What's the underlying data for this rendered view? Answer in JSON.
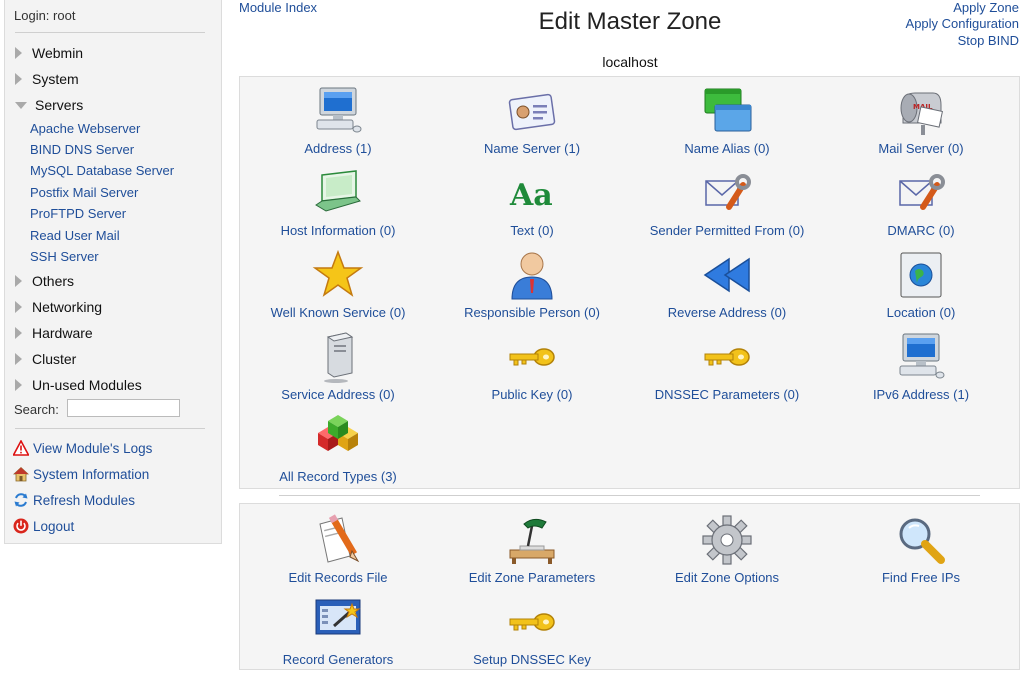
{
  "sidebar": {
    "login": "Login: root",
    "categories": [
      {
        "label": "Webmin"
      },
      {
        "label": "System"
      },
      {
        "label": "Servers"
      },
      {
        "label": "Others"
      },
      {
        "label": "Networking"
      },
      {
        "label": "Hardware"
      },
      {
        "label": "Cluster"
      },
      {
        "label": "Un-used Modules"
      }
    ],
    "servers": [
      "Apache Webserver",
      "BIND DNS Server",
      "MySQL Database Server",
      "Postfix Mail Server",
      "ProFTPD Server",
      "Read User Mail",
      "SSH Server"
    ],
    "search_label": "Search:",
    "search_value": "",
    "links": [
      {
        "label": "View Module's Logs",
        "icon": "warning-icon"
      },
      {
        "label": "System Information",
        "icon": "house-icon"
      },
      {
        "label": "Refresh Modules",
        "icon": "refresh-icon"
      },
      {
        "label": "Logout",
        "icon": "power-icon"
      }
    ]
  },
  "header": {
    "module_index": "Module Index",
    "title": "Edit Master Zone",
    "subtitle": "localhost",
    "right_links": [
      "Apply Zone",
      "Apply Configuration",
      "Stop BIND"
    ]
  },
  "records": [
    {
      "label": "Address (1)",
      "icon": "computer-icon"
    },
    {
      "label": "Name Server (1)",
      "icon": "id-card-icon"
    },
    {
      "label": "Name Alias (0)",
      "icon": "windows-icon"
    },
    {
      "label": "Mail Server (0)",
      "icon": "mailbox-icon"
    },
    {
      "label": "Host Information (0)",
      "icon": "laptop-icon"
    },
    {
      "label": "Text (0)",
      "icon": "text-aa-icon"
    },
    {
      "label": "Sender Permitted From (0)",
      "icon": "mail-wrench-icon"
    },
    {
      "label": "DMARC (0)",
      "icon": "mail-wrench-icon"
    },
    {
      "label": "Well Known Service (0)",
      "icon": "star-icon"
    },
    {
      "label": "Responsible Person (0)",
      "icon": "person-icon"
    },
    {
      "label": "Reverse Address (0)",
      "icon": "rewind-icon"
    },
    {
      "label": "Location (0)",
      "icon": "globe-icon"
    },
    {
      "label": "Service Address (0)",
      "icon": "server-icon"
    },
    {
      "label": "Public Key (0)",
      "icon": "key-icon"
    },
    {
      "label": "DNSSEC Parameters (0)",
      "icon": "key-icon"
    },
    {
      "label": "IPv6 Address (1)",
      "icon": "computer-icon"
    },
    {
      "label": "All Record Types (3)",
      "icon": "cubes-icon"
    }
  ],
  "actions": [
    {
      "label": "Edit Records File",
      "icon": "pencil-paper-icon"
    },
    {
      "label": "Edit Zone Parameters",
      "icon": "desk-lamp-icon"
    },
    {
      "label": "Edit Zone Options",
      "icon": "gear-icon"
    },
    {
      "label": "Find Free IPs",
      "icon": "magnifier-icon"
    },
    {
      "label": "Record Generators",
      "icon": "wand-icon"
    },
    {
      "label": "Setup DNSSEC Key",
      "icon": "key-icon"
    }
  ],
  "colors": {
    "link": "#1f4e99",
    "panel": "#f5f5f5",
    "sidebar": "#f3f3f3"
  }
}
